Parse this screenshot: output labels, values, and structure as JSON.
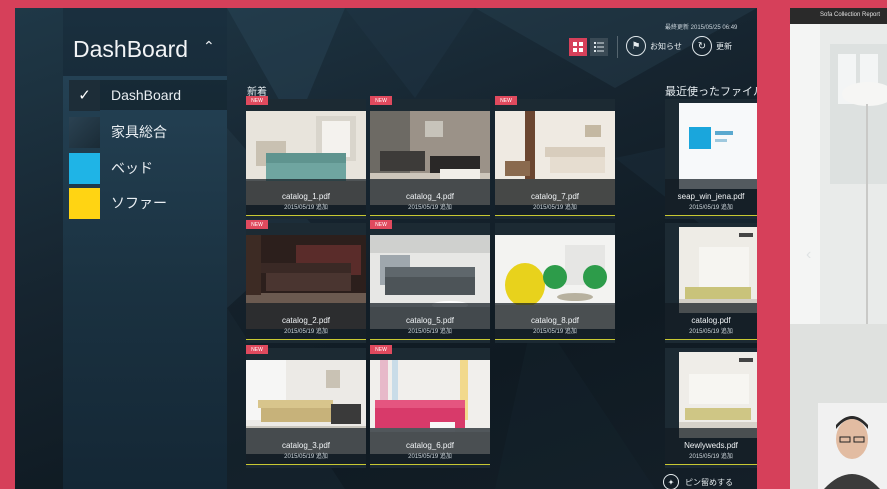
{
  "sidebar": {
    "title": "DashBoard",
    "collapse_icon": "chevron-up-double-icon",
    "items": [
      {
        "label": "DashBoard",
        "icon": "check-icon"
      },
      {
        "label": "家具総合"
      },
      {
        "label": "ベッド"
      },
      {
        "label": "ソファー"
      }
    ]
  },
  "topbar": {
    "updated": "最終更新 2015/05/25 06:49",
    "notice_label": "お知らせ",
    "refresh_label": "更新"
  },
  "sections": {
    "new": "新着",
    "recent": "最近使ったファイル"
  },
  "badge_label": "NEW",
  "cards": [
    {
      "name": "catalog_1.pdf",
      "date": "2015/05/19 追加"
    },
    {
      "name": "catalog_4.pdf",
      "date": "2015/05/19 追加"
    },
    {
      "name": "catalog_7.pdf",
      "date": "2015/05/19 追加"
    },
    {
      "name": "catalog_2.pdf",
      "date": "2015/05/19 追加"
    },
    {
      "name": "catalog_5.pdf",
      "date": "2015/05/19 追加"
    },
    {
      "name": "catalog_8.pdf",
      "date": "2015/05/19 追加"
    },
    {
      "name": "catalog_3.pdf",
      "date": "2015/05/19 追加"
    },
    {
      "name": "catalog_6.pdf",
      "date": "2015/05/19 追加"
    }
  ],
  "recent": [
    {
      "name": "seap_win_jena.pdf",
      "date": "2015/05/19 追加"
    },
    {
      "name": "catalog.pdf",
      "date": "2015/05/19 追加"
    },
    {
      "name": "Newlyweds.pdf",
      "date": "2015/05/19 追加"
    }
  ],
  "pin_label": "ピン留めする",
  "right_window": {
    "title": "Sofa Collection Report"
  },
  "colors": {
    "accent": "#d6405a",
    "bed": "#1fb4e6",
    "sofa": "#ffd413",
    "card_bar": "#c8c832"
  }
}
